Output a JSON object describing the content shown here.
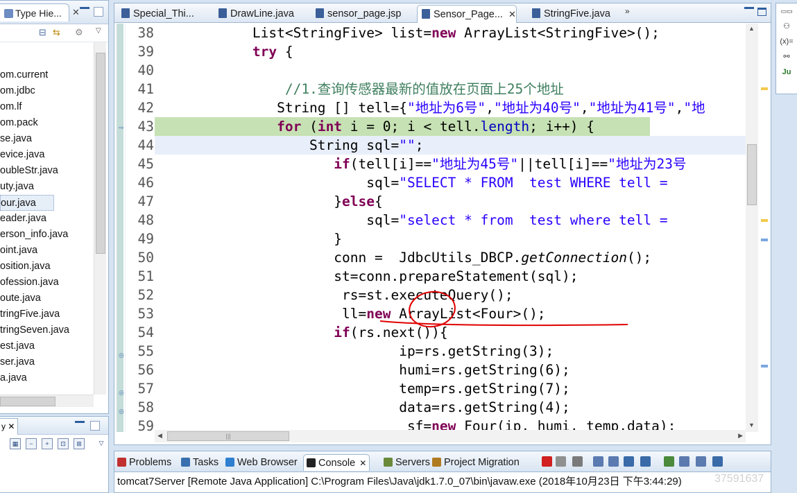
{
  "left_panel": {
    "tab_label": "Type Hie...",
    "items": [
      "om.current",
      "om.jdbc",
      "om.lf",
      "om.pack",
      "se.java",
      "evice.java",
      "oubleStr.java",
      "uty.java",
      "our.java",
      "eader.java",
      "erson_info.java",
      "oint.java",
      "osition.java",
      "ofession.java",
      "oute.java",
      "tringFive.java",
      "tringSeven.java",
      "est.java",
      "ser.java",
      "a.java"
    ],
    "selected_index": 8,
    "bottom_tab_label": "y",
    "bottom_close": "✕"
  },
  "editor": {
    "tabs": [
      {
        "label": "Special_Thi...",
        "active": false,
        "close": ""
      },
      {
        "label": "DrawLine.java",
        "active": false,
        "close": ""
      },
      {
        "label": "sensor_page.jsp",
        "active": false,
        "close": ""
      },
      {
        "label": "Sensor_Page...",
        "active": true,
        "close": "✕"
      },
      {
        "label": "StringFive.java",
        "active": false,
        "close": ""
      }
    ],
    "overflow": "»",
    "line_numbers": [
      "38",
      "39",
      "40",
      "41",
      "42",
      "43",
      "44",
      "45",
      "46",
      "47",
      "48",
      "49",
      "50",
      "51",
      "52",
      "53",
      "54",
      "55",
      "56",
      "57",
      "58",
      "59"
    ],
    "highlight_line": "43",
    "current_line": "44"
  },
  "code": {
    "l38": {
      "pre": "            List<StringFive> list=",
      "kw": "new",
      "post": " ArrayList<StringFive>();"
    },
    "l39": {
      "indent": "            ",
      "kw": "try",
      "post": " {"
    },
    "l41": {
      "indent": "                ",
      "comment": "//1.查询传感器最新的值放在页面上25个地址"
    },
    "l42": {
      "pre": "               String [] tell={",
      "s1": "\"地址为6号\"",
      "c1": ",",
      "s2": "\"地址为40号\"",
      "c2": ",",
      "s3": "\"地址为41号\"",
      "c3": ",",
      "s4": "\"地"
    },
    "l43": {
      "indent": "               ",
      "kw1": "for",
      "p1": " (",
      "kw2": "int",
      "p2": " i = 0; i < tell.",
      "fld": "length",
      "p3": "; i++) {"
    },
    "l44": {
      "pre": "                   String sql=",
      "str": "\"\"",
      "post": ";"
    },
    "l45": {
      "indent": "                      ",
      "kw": "if",
      "p1": "(tell[i]==",
      "s1": "\"地址为45号\"",
      "p2": "||tell[i]==",
      "s2": "\"地址为23号"
    },
    "l46": {
      "pre": "                          sql=",
      "str": "\"SELECT * FROM  test WHERE tell ="
    },
    "l47": {
      "pre": "                      }",
      "kw": "else",
      "post": "{"
    },
    "l48": {
      "pre": "                          sql=",
      "str": "\"select * from  test where tell ="
    },
    "l49": {
      "text": "                      }"
    },
    "l50": {
      "pre": "                      conn =  JdbcUtils_DBCP.",
      "it": "getConnection",
      "post": "();"
    },
    "l51": {
      "text": "                      st=conn.prepareStatement(sql);"
    },
    "l52": {
      "text": "                       rs=st.executeQuery();"
    },
    "l53": {
      "pre": "                       ll=",
      "kw": "new",
      "post": " ArrayList<Four>();"
    },
    "l54": {
      "indent": "                      ",
      "kw": "if",
      "post": "(rs.next()){"
    },
    "l55": {
      "text": "                              ip=rs.getString(3);"
    },
    "l56": {
      "text": "                              humi=rs.getString(6);"
    },
    "l57": {
      "text": "                              temp=rs.getString(7);"
    },
    "l58": {
      "text": "                              data=rs.getString(4);"
    },
    "l59": {
      "pre": "                               sf=",
      "kw": "new",
      "post": " Four(ip, humi, temp,data);"
    }
  },
  "console": {
    "tabs": [
      {
        "label": "Problems",
        "icon_color": "#c03030"
      },
      {
        "label": "Tasks",
        "icon_color": "#3a70b0"
      },
      {
        "label": "Web Browser",
        "icon_color": "#2f7fd0"
      },
      {
        "label": "Console",
        "icon_color": "#222222"
      },
      {
        "label": "Servers",
        "icon_color": "#6a8a3a"
      },
      {
        "label": "Project Migration",
        "icon_color": "#b07a20"
      }
    ],
    "active_tab": "Console",
    "console_close": "✕",
    "status_line": "tomcat7Server [Remote Java Application] C:\\Program Files\\Java\\jdk1.7.0_07\\bin\\javaw.exe (2018年10月23日 下午3:44:29)"
  },
  "right_bar": {
    "items": [
      "⚇",
      "(x)=",
      "⚯",
      "Ju"
    ]
  },
  "watermark": "37591637",
  "colors": {
    "keyword": "#7f0055",
    "string": "#2a00ff",
    "comment": "#3f7f5f",
    "field": "#0000c0",
    "highlight": "#c6e1b3",
    "annotation": "#e00000"
  }
}
